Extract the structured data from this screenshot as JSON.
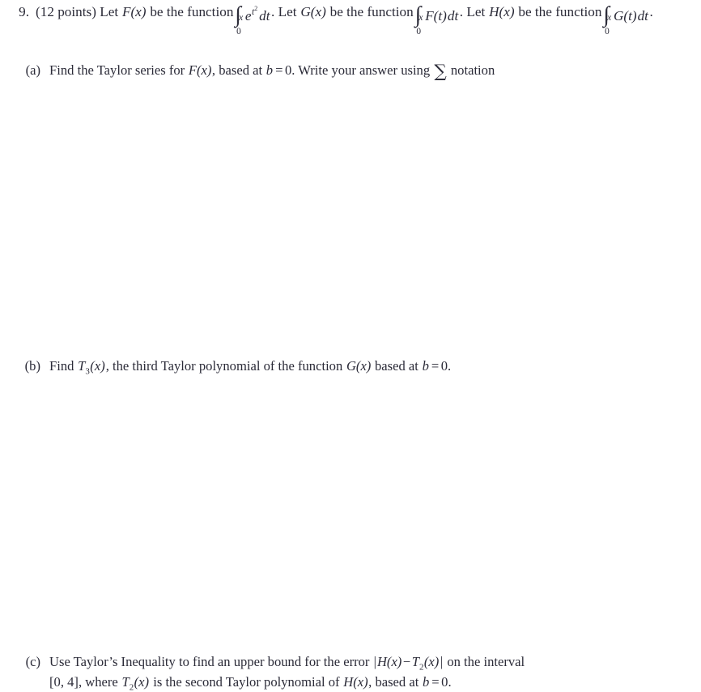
{
  "document": {
    "background_color": "#ffffff",
    "text_color": "#2b2b38",
    "problem": {
      "number": "9.",
      "points_note": "(12 points)",
      "stem_part1": "Let",
      "stem_F": "F(x)",
      "stem_part2": "be the function",
      "integral_1": {
        "symbol": "∫",
        "lower_limit": "0",
        "upper_limit": "x",
        "integrand": "e^{t^2}",
        "differential": "dt",
        "trailing": "."
      },
      "stem_part3": "Let",
      "stem_G": "G(x)",
      "stem_part4": "be the function",
      "integral_2": {
        "symbol": "∫",
        "lower_limit": "0",
        "upper_limit": "x",
        "integrand": "F(t)",
        "differential": "dt",
        "trailing": "."
      },
      "stem_part5": "Let",
      "stem_H": "H(x)",
      "stem_part6": "be the function",
      "integral_3": {
        "symbol": "∫",
        "lower_limit": "0",
        "upper_limit": "x",
        "integrand": "G(t)",
        "differential": "dt",
        "trailing": "."
      }
    },
    "parts": [
      {
        "label": "(a)",
        "text_1": "Find the Taylor series for",
        "math_1": "F(x)",
        "text_2": ", based at",
        "math_b": "b",
        "math_eq": "=",
        "math_zero": "0",
        "text_3": ". Write your answer using",
        "sigma": "∑",
        "text_4": "notation"
      },
      {
        "label": "(b)",
        "text_1": "Find",
        "math_T": "T",
        "math_T_sub": "3",
        "math_T_arg": "(x)",
        "text_2": ", the third Taylor polynomial of the function",
        "math_G": "G(x)",
        "text_3": "based at",
        "math_b": "b",
        "math_eq": "=",
        "math_zero": "0",
        "text_4": "."
      },
      {
        "label": "(c)",
        "text_1": "Use Taylor’s Inequality to find an upper bound for the error",
        "math_abs_open": "|",
        "math_H": "H(x)",
        "math_minus": "−",
        "math_T": "T",
        "math_T_sub": "2",
        "math_T_arg": "(x)",
        "math_abs_close": "|",
        "text_2": "on the interval",
        "interval": "[0, 4]",
        "text_3": ", where",
        "math_T2": "T",
        "math_T2_sub": "2",
        "math_T2_arg": "(x)",
        "text_4": "is the second Taylor polynomial of",
        "math_H2": "H(x)",
        "text_5": ", based at",
        "math_b": "b",
        "math_eq": "=",
        "math_zero": "0",
        "text_6": "."
      }
    ]
  }
}
